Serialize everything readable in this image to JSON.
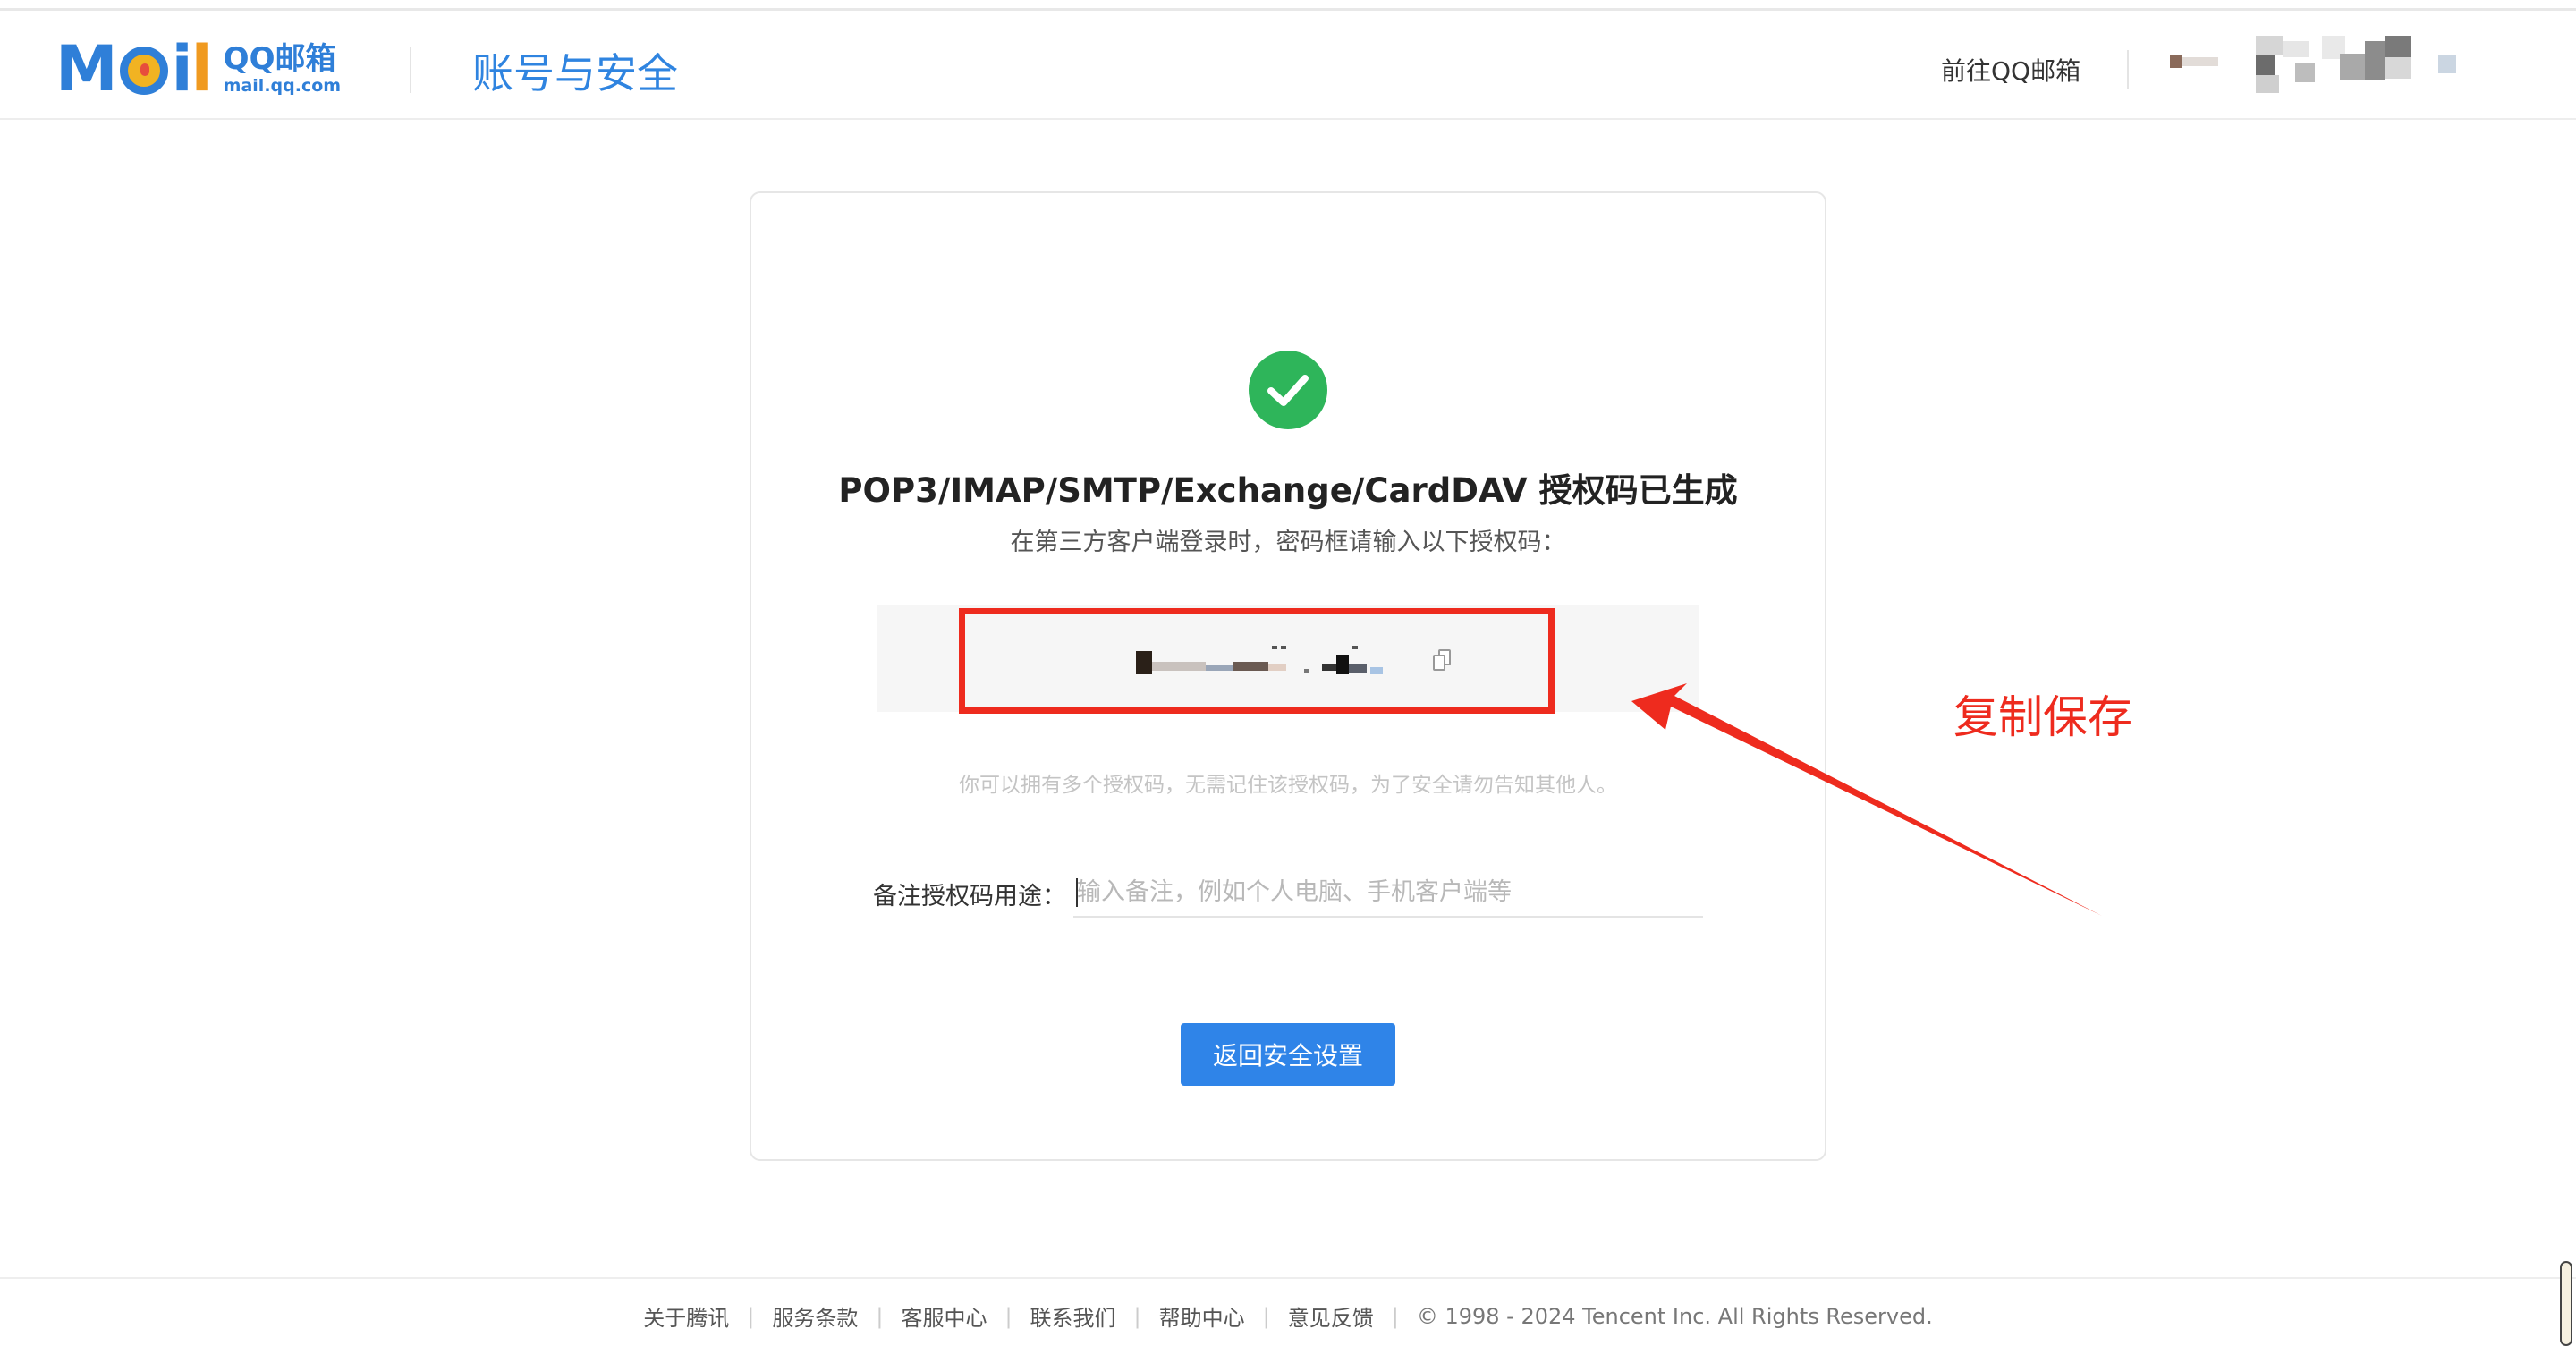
{
  "header": {
    "logo_mail": "M",
    "logo_i": "i",
    "logo_l": "l",
    "logo_product": "QQ邮箱",
    "logo_domain": "mail.qq.com",
    "title": "账号与安全",
    "goto_link": "前往QQ邮箱"
  },
  "result": {
    "title": "POP3/IMAP/SMTP/Exchange/CardDAV 授权码已生成",
    "subtitle": "在第三方客户端登录时，密码框请输入以下授权码：",
    "hint": "你可以拥有多个授权码，无需记住该授权码，为了安全请勿告知其他人。"
  },
  "note": {
    "label": "备注授权码用途：",
    "placeholder": "输入备注，例如个人电脑、手机客户端等",
    "value": ""
  },
  "actions": {
    "back_label": "返回安全设置"
  },
  "annotation": {
    "text": "复制保存",
    "color": "#ee2b1e"
  },
  "footer": {
    "links": [
      "关于腾讯",
      "服务条款",
      "客服中心",
      "联系我们",
      "帮助中心",
      "意见反馈"
    ],
    "copyright": "© 1998 - 2024 Tencent Inc. All Rights Reserved."
  },
  "colors": {
    "brand_blue": "#2f84e0",
    "success_green": "#2eb55a",
    "button_blue": "#2f84e8"
  }
}
